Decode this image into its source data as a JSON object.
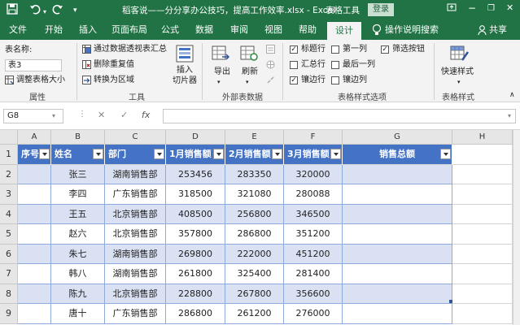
{
  "titlebar": {
    "document_title": "稻客说——分分享办公技巧，提高工作效率.xlsx  -  Excel",
    "context_label": "表格工具",
    "login_label": "登录",
    "save_icon": "save-icon",
    "undo_icon": "undo-icon",
    "redo_icon": "redo-icon",
    "minimize_glyph": "−",
    "restore_glyph": "❐",
    "close_glyph": "✕"
  },
  "tabs": [
    "文件",
    "开始",
    "插入",
    "页面布局",
    "公式",
    "数据",
    "审阅",
    "视图",
    "帮助",
    "设计"
  ],
  "active_tab": "设计",
  "tell_me": "操作说明搜索",
  "share": "共享",
  "ribbon": {
    "properties": {
      "name_label": "表名称:",
      "name_value": "表3",
      "resize_label": "调整表格大小",
      "group_label": "属性"
    },
    "tools": {
      "pivot_label": "通过数据透视表汇总",
      "dedupe_label": "删除重复值",
      "convert_label": "转换为区域",
      "slicer_label_1": "插入",
      "slicer_label_2": "切片器",
      "group_label": "工具"
    },
    "external": {
      "export_label": "导出",
      "refresh_label": "刷新",
      "group_label": "外部表数据"
    },
    "style_options": {
      "header_row": {
        "label": "标题行",
        "checked": true
      },
      "total_row": {
        "label": "汇总行",
        "checked": false
      },
      "banded_rows": {
        "label": "镶边行",
        "checked": true
      },
      "first_column": {
        "label": "第一列",
        "checked": false
      },
      "last_column": {
        "label": "最后一列",
        "checked": false
      },
      "banded_columns": {
        "label": "镶边列",
        "checked": false
      },
      "filter_button": {
        "label": "筛选按钮",
        "checked": true
      },
      "group_label": "表格样式选项"
    },
    "styles": {
      "quick_styles_label": "快速样式",
      "group_label": "表格样式"
    }
  },
  "formula_bar": {
    "cell_reference": "G8",
    "cancel_glyph": "✕",
    "enter_glyph": "✓",
    "fx_glyph": "fx",
    "formula": ""
  },
  "sheet": {
    "columns": [
      "A",
      "B",
      "C",
      "D",
      "E",
      "F",
      "G",
      "H"
    ],
    "rows": [
      "1",
      "2",
      "3",
      "4",
      "5",
      "6",
      "7",
      "8",
      "9"
    ],
    "headers": [
      "序号",
      "姓名",
      "部门",
      "1月销售额",
      "2月销售额",
      "3月销售额",
      "销售总额"
    ],
    "data": [
      [
        "",
        "张三",
        "湖南销售部",
        "253456",
        "283350",
        "320000",
        ""
      ],
      [
        "",
        "李四",
        "广东销售部",
        "318500",
        "321080",
        "280088",
        ""
      ],
      [
        "",
        "王五",
        "北京销售部",
        "408500",
        "256800",
        "346500",
        ""
      ],
      [
        "",
        "赵六",
        "北京销售部",
        "357800",
        "286800",
        "351200",
        ""
      ],
      [
        "",
        "朱七",
        "湖南销售部",
        "269800",
        "222000",
        "451200",
        ""
      ],
      [
        "",
        "韩八",
        "湖南销售部",
        "261800",
        "325400",
        "281400",
        ""
      ],
      [
        "",
        "陈九",
        "北京销售部",
        "228800",
        "267800",
        "356600",
        ""
      ],
      [
        "",
        "唐十",
        "广东销售部",
        "286800",
        "261200",
        "276000",
        ""
      ]
    ]
  },
  "colors": {
    "excel_green": "#217346",
    "table_header": "#4472c4",
    "table_band": "#d9e1f2"
  }
}
